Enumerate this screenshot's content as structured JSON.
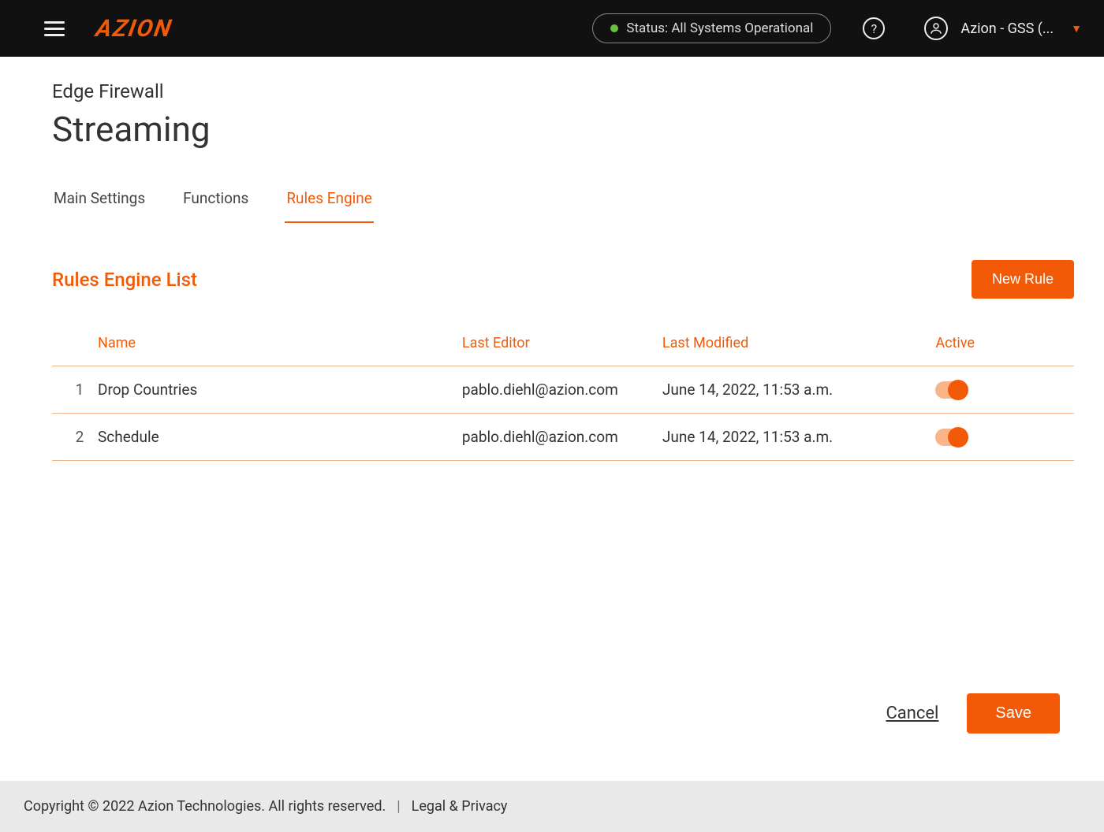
{
  "header": {
    "status_label": "Status: All Systems Operational",
    "user_label": "Azion - GSS (...",
    "logo_text": "AZION"
  },
  "page": {
    "breadcrumb": "Edge Firewall",
    "title": "Streaming"
  },
  "tabs": [
    {
      "label": "Main Settings",
      "active": false
    },
    {
      "label": "Functions",
      "active": false
    },
    {
      "label": "Rules Engine",
      "active": true
    }
  ],
  "list": {
    "title": "Rules Engine List",
    "new_button_label": "New Rule",
    "columns": {
      "name": "Name",
      "editor": "Last Editor",
      "modified": "Last Modified",
      "active": "Active"
    },
    "rows": [
      {
        "idx": "1",
        "name": "Drop Countries",
        "editor": "pablo.diehl@azion.com",
        "modified": "June 14, 2022, 11:53 a.m.",
        "active": true
      },
      {
        "idx": "2",
        "name": "Schedule",
        "editor": "pablo.diehl@azion.com",
        "modified": "June 14, 2022, 11:53 a.m.",
        "active": true
      }
    ]
  },
  "actions": {
    "cancel": "Cancel",
    "save": "Save"
  },
  "footer": {
    "copyright": "Copyright © 2022 Azion Technologies. All rights reserved.",
    "sep": "|",
    "legal": "Legal & Privacy"
  }
}
